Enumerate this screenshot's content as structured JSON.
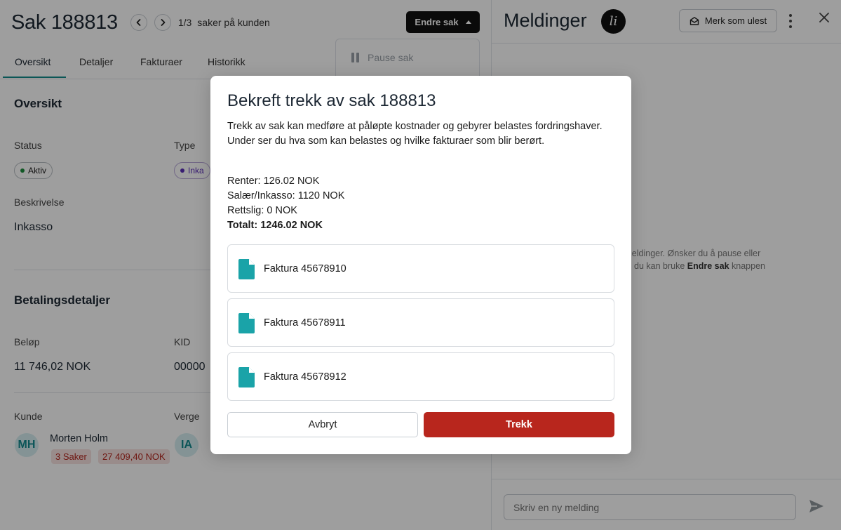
{
  "case": {
    "title": "Sak 188813",
    "position": "1/3",
    "position_suffix": "saker på kunden",
    "action_button": "Endre sak",
    "dropdown_item": "Pause sak"
  },
  "tabs": [
    {
      "label": "Oversikt"
    },
    {
      "label": "Detaljer"
    },
    {
      "label": "Fakturaer"
    },
    {
      "label": "Historikk"
    }
  ],
  "overview": {
    "section_title": "Oversikt",
    "status_label": "Status",
    "status_value": "Aktiv",
    "status_color": "#1e8e3e",
    "type_label": "Type",
    "type_value": "Inka",
    "type_color": "#5b2fb8",
    "description_label": "Beskrivelse",
    "description_value": "Inkasso"
  },
  "payment": {
    "section_title": "Betalingsdetaljer",
    "amount_label": "Beløp",
    "amount_value": "11 746,02 NOK",
    "kid_label": "KID",
    "kid_value": "00000"
  },
  "customer": {
    "label": "Kunde",
    "initials": "MH",
    "name": "Morten Holm",
    "cases_chip": "3 Saker",
    "amount_chip": "27 409,40 NOK"
  },
  "guardian": {
    "label": "Verge",
    "initials": "IA"
  },
  "messages": {
    "title": "Meldinger",
    "logo_text": "li",
    "mark_unread": "Merk som ulest",
    "empty_text_1": "en meldinger. Ønsker du å pause eller",
    "empty_text_2": "du kan bruke",
    "empty_text_bold": "Endre sak",
    "empty_text_3": "knappen",
    "composer_placeholder": "Skriv en ny melding"
  },
  "modal": {
    "title": "Bekreft trekk av sak 188813",
    "description": "Trekk av sak kan medføre at påløpte kostnader og gebyrer belastes fordringshaver. Under ser du hva som kan belastes og hvilke fakturaer som blir berørt.",
    "costs": [
      "Renter: 126.02 NOK",
      "Salær/Inkasso: 1120 NOK",
      "Rettslig: 0 NOK"
    ],
    "total": "Totalt: 1246.02 NOK",
    "invoices": [
      {
        "label": "Faktura 45678910"
      },
      {
        "label": "Faktura 45678911"
      },
      {
        "label": "Faktura 45678912"
      }
    ],
    "cancel_label": "Avbryt",
    "confirm_label": "Trekk"
  },
  "colors": {
    "accent_teal": "#128c8c",
    "danger_red": "#b8261d",
    "document_icon": "#1aa3a8"
  }
}
